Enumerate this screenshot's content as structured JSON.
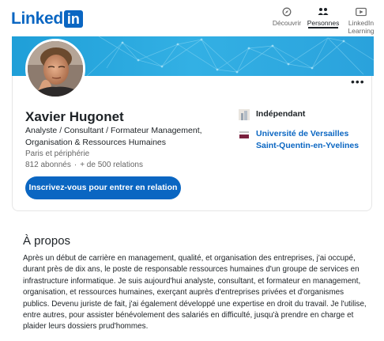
{
  "nav": {
    "logo_text": "Linked",
    "logo_box": "in",
    "items": [
      {
        "label": "Découvrir",
        "icon": "compass-icon"
      },
      {
        "label": "Personnes",
        "icon": "people-icon"
      },
      {
        "label": "LinkedIn Learning",
        "icon": "play-icon"
      }
    ],
    "active": "Personnes"
  },
  "profile": {
    "name": "Xavier Hugonet",
    "headline": "Analyste / Consultant / Formateur Management, Organisation & Ressources Humaines",
    "location": "Paris et périphérie",
    "followers": "812 abonnés",
    "relations": "+ de 500 relations",
    "connect_label": "Inscrivez-vous pour entrer en relation",
    "company": "Indépendant",
    "school": "Université de Versailles Saint-Quentin-en-Yvelines",
    "more_icon": "ellipsis-icon"
  },
  "about": {
    "title": "À propos",
    "text": "Après un début de carrière en management, qualité, et organisation des entreprises, j'ai occupé, durant près de dix ans, le poste de responsable ressources humaines d'un groupe de services en infrastructure informatique. Je suis aujourd'hui analyste, consultant, et formateur en management, organisation, et ressources humaines, exerçant auprès d'entreprises privées et d'organismes publics. Devenu juriste de fait, j'ai également développé une expertise en droit du travail. Je l'utilise, entre autres, pour assister bénévolement des salariés en difficulté, jusqu'à prendre en charge et plaider leurs dossiers prud'hommes."
  },
  "colors": {
    "brand": "#0a66c2",
    "banner": "#2aa9e0",
    "text_muted": "#666666"
  }
}
